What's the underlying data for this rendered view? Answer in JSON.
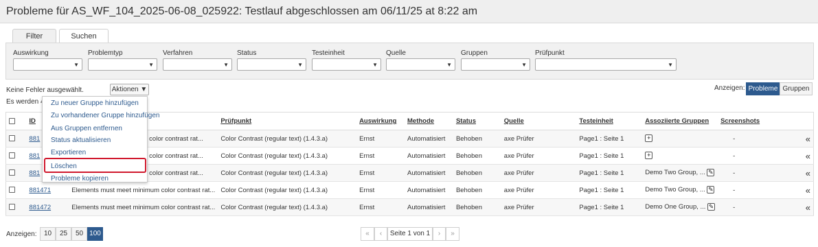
{
  "title": "Probleme für AS_WF_104_2025-06-08_025922: Testlauf abgeschlossen am 06/11/25 at 8:22 am",
  "tabs": [
    {
      "label": "Filter"
    },
    {
      "label": "Suchen"
    }
  ],
  "filters": [
    {
      "label": "Auswirkung"
    },
    {
      "label": "Problemtyp"
    },
    {
      "label": "Verfahren"
    },
    {
      "label": "Status"
    },
    {
      "label": "Testeinheit"
    },
    {
      "label": "Quelle"
    },
    {
      "label": "Gruppen"
    },
    {
      "label": "Prüfpunkt"
    }
  ],
  "selection_text": "Keine Fehler ausgewählt.",
  "count_text": "Es werden 42",
  "actions_label": "Aktionen",
  "actions_menu": [
    "Zu neuer Gruppe hinzufügen",
    "Zu vorhandener Gruppe hinzufügen",
    "Aus Gruppen entfernen",
    "Status aktualisieren",
    "Exportieren",
    "Löschen",
    "Probleme kopieren"
  ],
  "highlighted_action": "Löschen",
  "view_toggle": {
    "label": "Anzeigen:",
    "options": [
      "Probleme",
      "Gruppen"
    ],
    "selected": "Probleme"
  },
  "table": {
    "columns": [
      "ID",
      "Prüfpunkt",
      "Auswirkung",
      "Methode",
      "Status",
      "Quelle",
      "Testeinheit",
      "Assoziierte Gruppen",
      "Screenshots"
    ],
    "rows": [
      {
        "id": "881",
        "desc": "n color contrast rat...",
        "pruefpunkt": "Color Contrast (regular text) (1.4.3.a)",
        "auswirkung": "Ernst",
        "methode": "Automatisiert",
        "status": "Behoben",
        "quelle": "axe Prüfer",
        "testeinheit": "Page1 : Seite 1",
        "gruppen": "",
        "screenshots": "-"
      },
      {
        "id": "881",
        "desc": "n color contrast rat...",
        "pruefpunkt": "Color Contrast (regular text) (1.4.3.a)",
        "auswirkung": "Ernst",
        "methode": "Automatisiert",
        "status": "Behoben",
        "quelle": "axe Prüfer",
        "testeinheit": "Page1 : Seite 1",
        "gruppen": "",
        "screenshots": "-"
      },
      {
        "id": "881",
        "desc": "n color contrast rat...",
        "pruefpunkt": "Color Contrast (regular text) (1.4.3.a)",
        "auswirkung": "Ernst",
        "methode": "Automatisiert",
        "status": "Behoben",
        "quelle": "axe Prüfer",
        "testeinheit": "Page1 : Seite 1",
        "gruppen": "Demo Two Group, ...",
        "screenshots": "-"
      },
      {
        "id": "881471",
        "desc": "Elements must meet minimum color contrast rat...",
        "pruefpunkt": "Color Contrast (regular text) (1.4.3.a)",
        "auswirkung": "Ernst",
        "methode": "Automatisiert",
        "status": "Behoben",
        "quelle": "axe Prüfer",
        "testeinheit": "Page1 : Seite 1",
        "gruppen": "Demo Two Group, ...",
        "screenshots": "-"
      },
      {
        "id": "881472",
        "desc": "Elements must meet minimum color contrast rat...",
        "pruefpunkt": "Color Contrast (regular text) (1.4.3.a)",
        "auswirkung": "Ernst",
        "methode": "Automatisiert",
        "status": "Behoben",
        "quelle": "axe Prüfer",
        "testeinheit": "Page1 : Seite 1",
        "gruppen": "Demo One Group, ...",
        "screenshots": "-"
      }
    ]
  },
  "page_size": {
    "label": "Anzeigen:",
    "options": [
      "10",
      "25",
      "50",
      "100"
    ],
    "selected": "100"
  },
  "pagination": {
    "first": "«",
    "prev": "‹",
    "page_text": "Seite 1 von 1",
    "next": "›",
    "last": "»"
  },
  "expand_glyph": "«",
  "colors": {
    "accent": "#2d5a8e",
    "highlight_border": "#d0182d"
  }
}
